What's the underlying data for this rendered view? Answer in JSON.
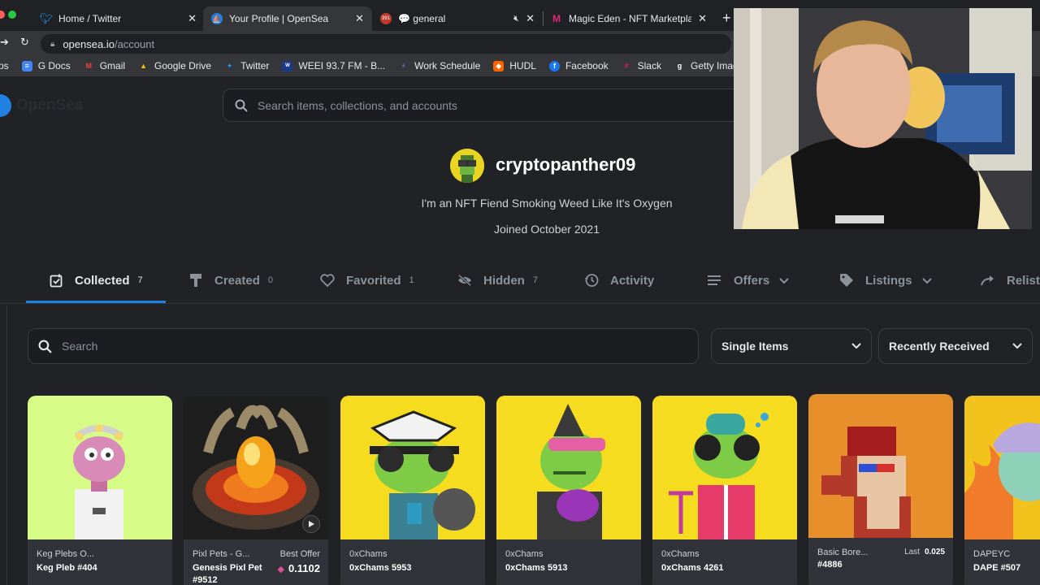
{
  "browser": {
    "tabs": [
      {
        "title": "Home / Twitter",
        "active": false
      },
      {
        "title": "Your Profile | OpenSea",
        "active": true
      },
      {
        "title": "💬 general",
        "active": false
      },
      {
        "title": "Magic Eden - NFT Marketplace",
        "active": false
      }
    ],
    "url_host": "opensea.io",
    "url_path": "/account",
    "bookmarks": [
      {
        "label": "ps"
      },
      {
        "label": "G Docs"
      },
      {
        "label": "Gmail"
      },
      {
        "label": "Google Drive"
      },
      {
        "label": "Twitter"
      },
      {
        "label": "WEEI 93.7 FM - B..."
      },
      {
        "label": "Work Schedule"
      },
      {
        "label": "HUDL"
      },
      {
        "label": "Facebook"
      },
      {
        "label": "Slack"
      },
      {
        "label": "Getty Images"
      }
    ],
    "tab_badge": "991"
  },
  "site": {
    "logo_text": "OpenSea",
    "search_placeholder": "Search items, collections, and accounts"
  },
  "profile": {
    "username": "cryptopanther09",
    "bio": "I'm an NFT Fiend Smoking Weed Like It's Oxygen",
    "joined": "Joined October 2021"
  },
  "profile_tabs": [
    {
      "label": "Collected",
      "count": "7",
      "icon": "collected-icon"
    },
    {
      "label": "Created",
      "count": "0",
      "icon": "paintbrush-icon"
    },
    {
      "label": "Favorited",
      "count": "1",
      "icon": "heart-icon"
    },
    {
      "label": "Hidden",
      "count": "7",
      "icon": "eye-off-icon"
    },
    {
      "label": "Activity",
      "count": "",
      "icon": "history-icon"
    },
    {
      "label": "Offers",
      "count": "",
      "icon": "list-icon"
    },
    {
      "label": "Listings",
      "count": "",
      "icon": "tag-icon"
    },
    {
      "label": "Relist",
      "count": "",
      "icon": "relist-icon"
    }
  ],
  "filters": {
    "search_placeholder": "Search",
    "item_type": "Single Items",
    "sort": "Recently Received"
  },
  "cards": [
    {
      "collection": "Keg Plebs O...",
      "name": "Keg Pleb #404"
    },
    {
      "collection": "Pixl Pets - G...",
      "name": "Genesis Pixl Pet #9512",
      "offer_label": "Best Offer",
      "offer_value": "0.1102"
    },
    {
      "collection": "0xChams",
      "name": "0xChams 5953"
    },
    {
      "collection": "0xChams",
      "name": "0xChams 5913"
    },
    {
      "collection": "0xChams",
      "name": "0xChams 4261"
    },
    {
      "collection": "Basic Bore...",
      "name": "#4886",
      "last_label": "Last",
      "last_value": "0.025"
    },
    {
      "collection": "DAPEYC",
      "name": "DAPE #507"
    }
  ],
  "colors": {
    "accent": "#2081e2",
    "page_bg": "#202225",
    "card_bg": "#303339",
    "eth_pink": "#e24c9b"
  }
}
